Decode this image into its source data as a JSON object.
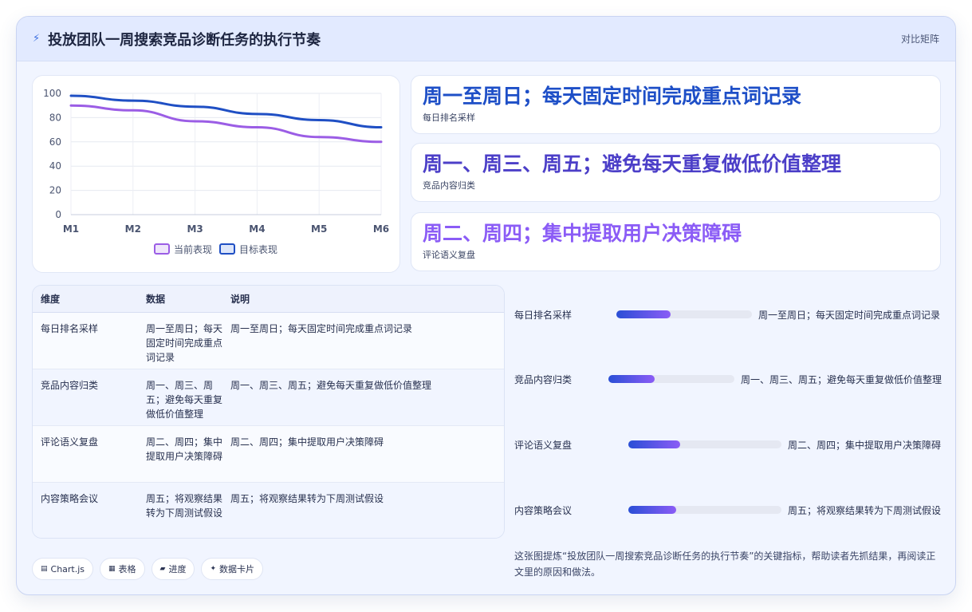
{
  "header": {
    "title": "投放团队一周搜索竞品诊断任务的执行节奏",
    "right_link": "对比矩阵",
    "icon": "lightning-icon"
  },
  "stats": [
    {
      "value": "周一至周日；每天固定时间完成重点词记录",
      "label": "每日排名采样",
      "color": "#1e4fc7"
    },
    {
      "value": "周一、周三、周五；避免每天重复做低价值整理",
      "label": "竞品内容归类",
      "color": "#4c3fc8"
    },
    {
      "value": "周二、周四；集中提取用户决策障碍",
      "label": "评论语义复盘",
      "color": "#8b5cf6"
    }
  ],
  "table": {
    "headers": [
      "维度",
      "数据",
      "说明"
    ],
    "rows": [
      {
        "dim": "每日排名采样",
        "data": "周一至周日；每天固定时间完成重点词记录",
        "desc": "周一至周日；每天固定时间完成重点词记录"
      },
      {
        "dim": "竞品内容归类",
        "data": "周一、周三、周五；避免每天重复做低价值整理",
        "desc": "周一、周三、周五；避免每天重复做低价值整理"
      },
      {
        "dim": "评论语义复盘",
        "data": "周二、周四；集中提取用户决策障碍",
        "desc": "周二、周四；集中提取用户决策障碍"
      },
      {
        "dim": "内容策略会议",
        "data": "周五；将观察结果转为下周测试假设",
        "desc": "周五；将观察结果转为下周测试假设"
      }
    ]
  },
  "progress": [
    {
      "label": "每日排名采样",
      "text": "周一至周日；每天固定时间完成重点词记录",
      "fill": 0.4
    },
    {
      "label": "竞品内容归类",
      "text": "周一、周三、周五；避免每天重复做低价值整理",
      "fill": 0.37
    },
    {
      "label": "评论语义复盘",
      "text": "周二、周四；集中提取用户决策障碍",
      "fill": 0.34
    },
    {
      "label": "内容策略会议",
      "text": "周五；将观察结果转为下周测试假设",
      "fill": 0.31
    }
  ],
  "note": "这张图提炼“投放团队一周搜索竞品诊断任务的执行节奏”的关键指标，帮助读者先抓结果，再阅读正文里的原因和做法。",
  "badges": [
    {
      "label": "Chart.js",
      "icon": "chart-icon"
    },
    {
      "label": "表格",
      "icon": "table-icon"
    },
    {
      "label": "进度",
      "icon": "progress-icon"
    },
    {
      "label": "数据卡片",
      "icon": "sparkle-icon"
    }
  ],
  "chart_data": {
    "type": "line",
    "categories": [
      "M1",
      "M2",
      "M3",
      "M4",
      "M5",
      "M6"
    ],
    "series": [
      {
        "name": "当前表现",
        "values": [
          90,
          86,
          77,
          72,
          64,
          60
        ],
        "color": "#9b5de5"
      },
      {
        "name": "目标表现",
        "values": [
          98,
          94,
          89,
          83,
          78,
          72
        ],
        "color": "#1f4fc4"
      }
    ],
    "ylim": [
      0,
      100
    ],
    "yticks": [
      0,
      20,
      40,
      60,
      80,
      100
    ],
    "grid": true,
    "legend": "bottom"
  }
}
